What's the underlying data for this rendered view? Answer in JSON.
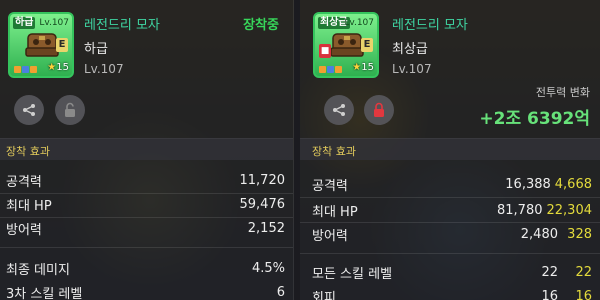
{
  "left": {
    "grade_badge": "하급",
    "level_badge": "Lv.107",
    "star_count": "15",
    "item_name": "레전드리 모자",
    "equipped": "장착중",
    "grade": "하급",
    "level": "Lv.107",
    "section_title": "장착 효과",
    "stats": [
      {
        "label": "공격력",
        "value": "11,720"
      },
      {
        "label": "최대 HP",
        "value": "59,476"
      },
      {
        "label": "방어력",
        "value": "2,152"
      }
    ],
    "extra_stats": [
      {
        "label": "최종 데미지",
        "value": "4.5%"
      },
      {
        "label": "3차 스킬 레벨",
        "value": "6"
      }
    ]
  },
  "right": {
    "grade_badge": "최상급",
    "level_badge": "Lv.107",
    "star_count": "15",
    "item_name": "레전드리 모자",
    "grade": "최상급",
    "level": "Lv.107",
    "power_label": "전투력 변화",
    "power_value": "+2조 6392억",
    "section_title": "장착 효과",
    "stats": [
      {
        "label": "공격력",
        "value": "16,388",
        "bonus": "4,668"
      },
      {
        "label": "최대 HP",
        "value": "81,780",
        "bonus": "22,304"
      },
      {
        "label": "방어력",
        "value": "2,480",
        "bonus": "328"
      }
    ],
    "extra_stats": [
      {
        "label": "모든 스킬 레벨",
        "value": "22",
        "bonus": "22"
      },
      {
        "label": "회피",
        "value": "16",
        "bonus": "16"
      }
    ]
  },
  "colors": {
    "item_name": "#3fd6a3",
    "equipped": "#37d65a",
    "power_gain": "#67e27a",
    "stat_bonus": "#e3da3c",
    "section_title": "#e0c95b"
  },
  "icons": [
    "share-icon",
    "lock-open-icon",
    "lock-closed-icon",
    "star-icon"
  ]
}
